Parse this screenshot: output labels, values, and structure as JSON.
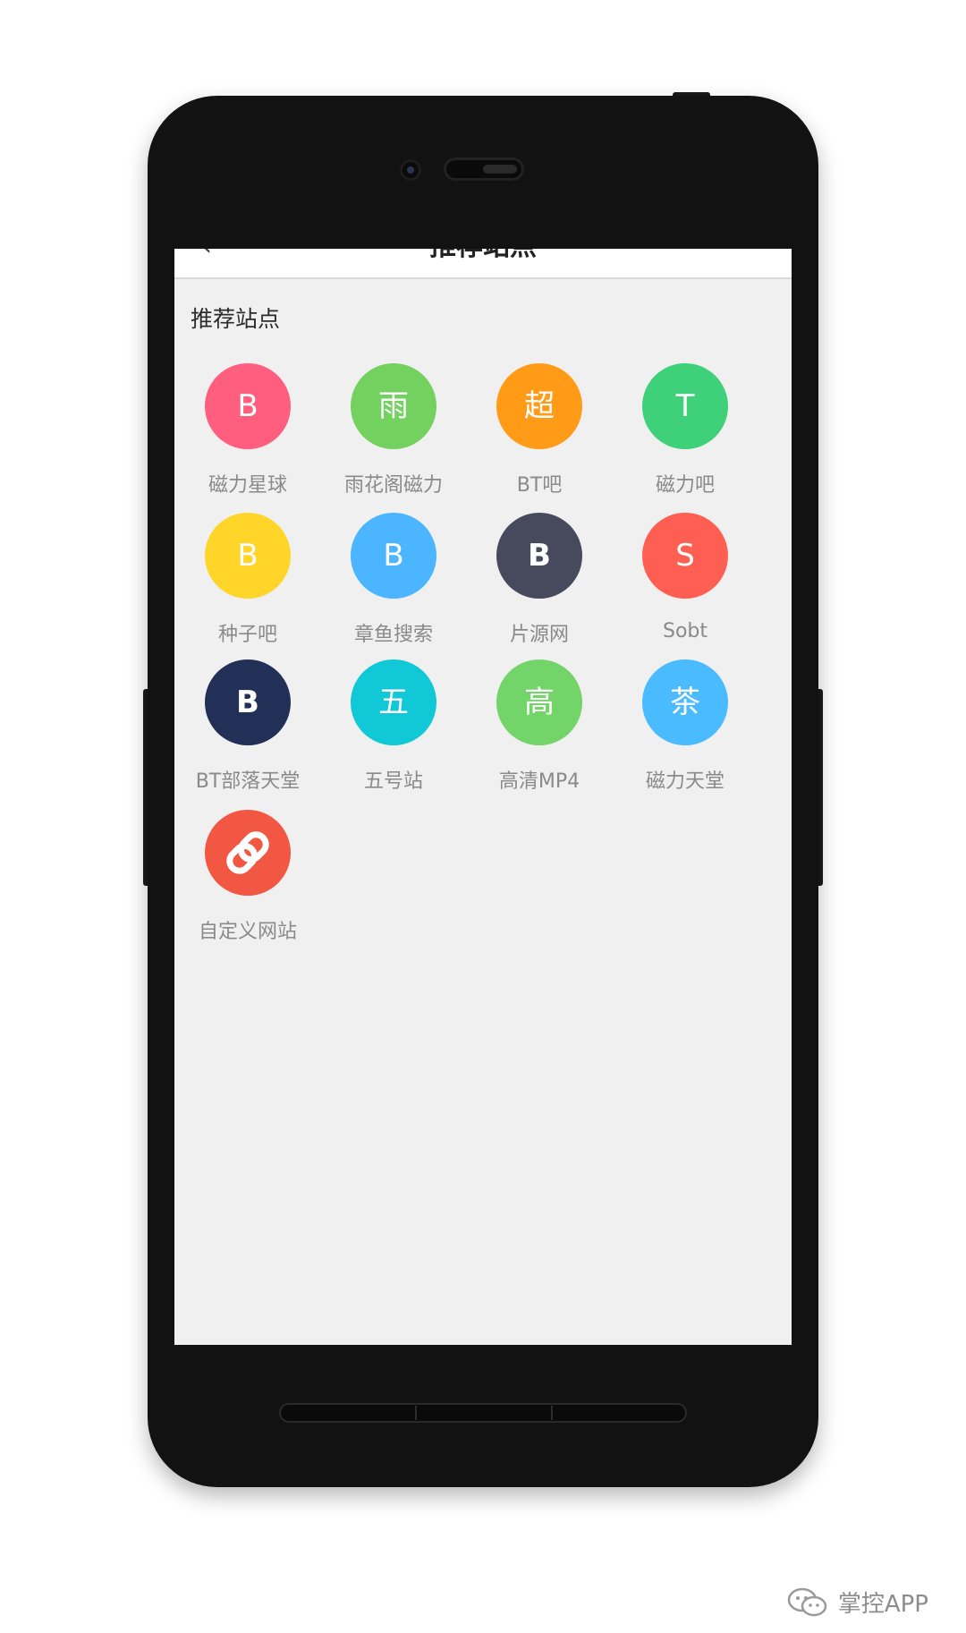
{
  "app": {
    "back_icon": "‹",
    "title": "推荐站点"
  },
  "section": {
    "title": "推荐站点"
  },
  "sites": [
    {
      "letter": "B",
      "label": "磁力星球",
      "color": "#FF5E7E",
      "icon": "letter-avatar"
    },
    {
      "letter": "雨",
      "label": "雨花阁磁力",
      "color": "#73D15F",
      "icon": "letter-avatar"
    },
    {
      "letter": "超",
      "label": "BT吧",
      "color": "#FF9B16",
      "icon": "letter-avatar"
    },
    {
      "letter": "T",
      "label": "磁力吧",
      "color": "#3FD07A",
      "icon": "letter-avatar"
    },
    {
      "letter": "B",
      "label": "种子吧",
      "color": "#FFD52A",
      "icon": "letter-avatar"
    },
    {
      "letter": "B",
      "label": "章鱼搜索",
      "color": "#4BB6FF",
      "icon": "letter-avatar"
    },
    {
      "letter": "B",
      "label": "片源网",
      "color": "#474A5D",
      "icon": "letter-avatar"
    },
    {
      "letter": "S",
      "label": "Sobt",
      "color": "#FF5F52",
      "icon": "letter-avatar"
    },
    {
      "letter": "B",
      "label": "BT部落天堂",
      "color": "#222F57",
      "icon": "letter-avatar"
    },
    {
      "letter": "五",
      "label": "五号站",
      "color": "#10C8D6",
      "icon": "letter-avatar"
    },
    {
      "letter": "高",
      "label": "高清MP4",
      "color": "#73D46A",
      "icon": "letter-avatar"
    },
    {
      "letter": "茶",
      "label": "磁力天堂",
      "color": "#4ABBFF",
      "icon": "letter-avatar"
    },
    {
      "letter": "",
      "label": "自定义网站",
      "color": "#F25744",
      "icon": "link-icon"
    }
  ],
  "watermark": {
    "text": "掌控APP",
    "icon": "wechat-icon"
  }
}
